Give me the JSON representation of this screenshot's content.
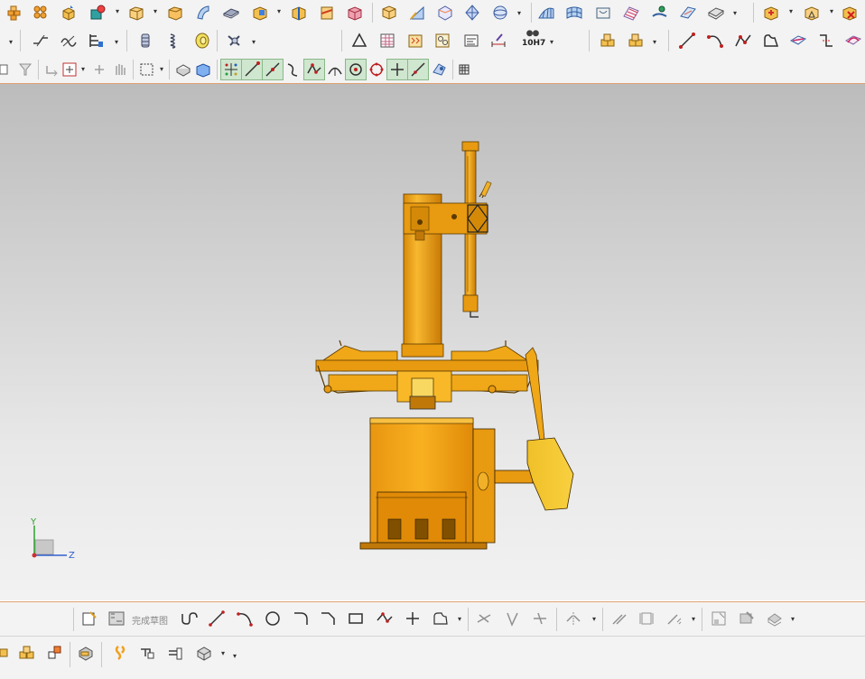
{
  "toolbar_top": {
    "icons": [
      "bricks-icon",
      "bricks-array-icon",
      "cube-move-icon",
      "extrude-icon",
      "box-icon",
      "box-open-icon",
      "sweep-icon",
      "plate-icon",
      "shell-icon",
      "shell-half-icon",
      "cut-box-icon",
      "box-color-icon",
      "fold-icon",
      "wedge-icon",
      "diamond-icon",
      "sphere-icon",
      "surface-icon",
      "grid-surface-icon",
      "patch-icon",
      "sheet-icon",
      "wave-icon",
      "ribbon-icon",
      "plane-icon",
      "boolean-icon",
      "draft-icon",
      "delete-icon"
    ]
  },
  "toolbar_mid": {
    "tolerance_label": "10H7",
    "icons": [
      "line-style-icon",
      "wave-style-icon",
      "hatch-icon",
      "spring-icon",
      "coil-icon",
      "disk-icon",
      "wrench-icon",
      "triangle-icon",
      "table-icon",
      "pattern-icon",
      "cog-pattern-icon",
      "note-icon",
      "dimension-icon",
      "tolerance-icon",
      "parts-icon",
      "assembly-icon",
      "line-icon",
      "arc-icon",
      "polyline-icon",
      "profile-icon",
      "plane-section-icon",
      "curve-edit-icon",
      "curve-project-icon"
    ]
  },
  "toolbar_snap": {
    "icons": [
      "select-icon",
      "filter-icon",
      "rotate-icon",
      "pan-icon",
      "box-select-icon",
      "view-shaded-icon",
      "view-solid-icon",
      "snap-point-icon",
      "snap-line-icon",
      "snap-tangent-icon",
      "snap-curve-icon",
      "snap-vertex-icon",
      "snap-arc-icon",
      "snap-center-icon",
      "snap-circle-icon",
      "snap-intersect-icon",
      "snap-onpath-icon",
      "snap-face-icon",
      "grid-icon"
    ]
  },
  "sketch_toolbar": {
    "finish_label": "完成草图",
    "icons": [
      "sketch-icon",
      "finish-sketch-icon",
      "profile-icon",
      "line-icon",
      "arc-icon",
      "circle-icon",
      "fillet-icon",
      "chamfer-icon",
      "rectangle-icon",
      "polyline-icon",
      "point-icon",
      "offset-icon",
      "trim-icon",
      "extend-icon",
      "split-icon",
      "mirror-icon",
      "constraint-icon",
      "dimension-icon",
      "align-icon",
      "reference-icon",
      "curve-icon",
      "surface-icon"
    ]
  },
  "bottom_toolbar": {
    "icons": [
      "move-icon",
      "assembly-icon",
      "array-icon",
      "mates-icon",
      "link-icon",
      "chain-icon",
      "motion-icon",
      "explode-icon"
    ]
  },
  "triad": {
    "y_label": "Y",
    "z_label": "Z"
  },
  "model": {
    "name": "tire-changer-machine"
  }
}
